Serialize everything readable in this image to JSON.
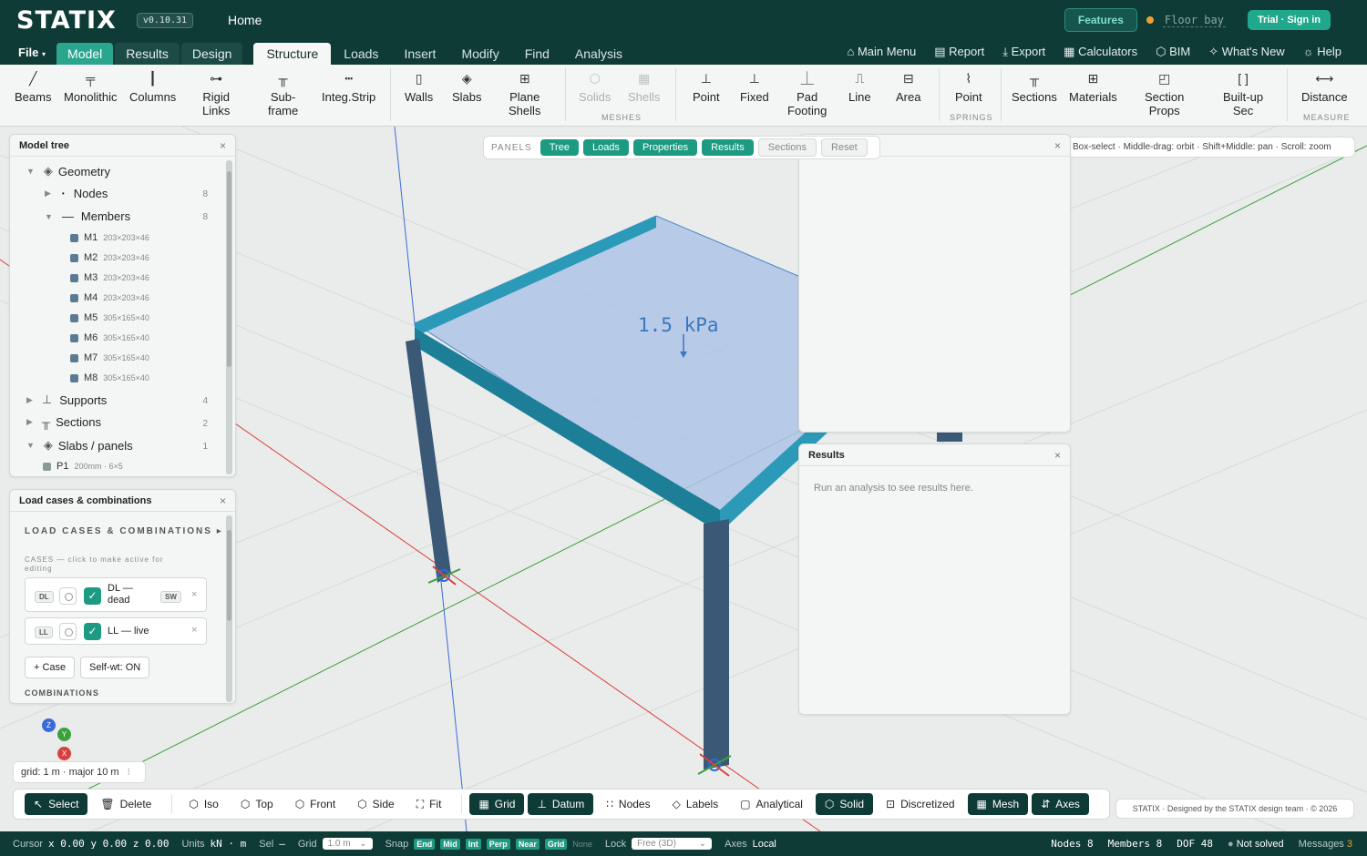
{
  "app": {
    "logo": "STATIX",
    "version": "v0.10.31",
    "home": "Home",
    "features": "Features",
    "project": "Floor bay",
    "trial": "Trial · Sign in"
  },
  "menu": {
    "file": "File",
    "tabs": [
      "Model",
      "Results",
      "Design"
    ],
    "subtabs": [
      "Structure",
      "Loads",
      "Insert",
      "Modify",
      "Find",
      "Analysis"
    ],
    "right": [
      "Main Menu",
      "Report",
      "Export",
      "Calculators",
      "BIM",
      "What's New",
      "Help"
    ]
  },
  "ribbon": {
    "items": [
      {
        "label": "Beams",
        "icon": "╱"
      },
      {
        "label": "Monolithic",
        "icon": "╤"
      },
      {
        "label": "Columns",
        "icon": "┃"
      },
      {
        "label": "Rigid\nLinks",
        "icon": "⊶"
      },
      {
        "label": "Sub-\nframe",
        "icon": "╥"
      },
      {
        "label": "Integ.Strip",
        "icon": "┅"
      },
      {
        "label": "Walls",
        "icon": "▯"
      },
      {
        "label": "Slabs",
        "icon": "◈"
      },
      {
        "label": "Plane\nShells",
        "icon": "⊞"
      },
      {
        "label": "Solids",
        "icon": "⬡"
      },
      {
        "label": "Shells",
        "icon": "▦"
      },
      {
        "label": "Point",
        "icon": "⊥"
      },
      {
        "label": "Fixed",
        "icon": "⊥"
      },
      {
        "label": "Pad\nFooting",
        "icon": "⏊"
      },
      {
        "label": "Line",
        "icon": "⎍"
      },
      {
        "label": "Area",
        "icon": "⊟"
      },
      {
        "label": "Point",
        "icon": "⌇"
      },
      {
        "label": "Sections",
        "icon": "╥"
      },
      {
        "label": "Materials",
        "icon": "⊞"
      },
      {
        "label": "Section\nProps",
        "icon": "◰"
      },
      {
        "label": "Built-up\nSec",
        "icon": "[ ]"
      },
      {
        "label": "Distance",
        "icon": "⟷"
      }
    ],
    "groups": [
      "MESHES",
      "SPRINGS",
      "MEASURE"
    ]
  },
  "tree": {
    "title": "Model tree",
    "geometry": "Geometry",
    "nodes": "Nodes",
    "nodes_count": "8",
    "members": "Members",
    "members_count": "8",
    "member_list": [
      {
        "id": "M1",
        "sec": "203×203×46"
      },
      {
        "id": "M2",
        "sec": "203×203×46"
      },
      {
        "id": "M3",
        "sec": "203×203×46"
      },
      {
        "id": "M4",
        "sec": "203×203×46"
      },
      {
        "id": "M5",
        "sec": "305×165×40"
      },
      {
        "id": "M6",
        "sec": "305×165×40"
      },
      {
        "id": "M7",
        "sec": "305×165×40"
      },
      {
        "id": "M8",
        "sec": "305×165×40"
      }
    ],
    "supports": "Supports",
    "supports_count": "4",
    "sections": "Sections",
    "sections_count": "2",
    "slabs": "Slabs / panels",
    "slabs_count": "1",
    "p1": "P1",
    "p1_desc": "200mm · 6×5"
  },
  "loads": {
    "title": "Load cases & combinations",
    "heading": "LOAD CASES & COMBINATIONS ▸",
    "cases_label": "CASES — click to make active for editing",
    "cases": [
      {
        "tag": "DL",
        "name": "DL —\ndead",
        "sw": "SW"
      },
      {
        "tag": "LL",
        "name": "LL — live"
      }
    ],
    "add_case": "+ Case",
    "selfwt": "Self-wt: ON",
    "combinations": "COMBINATIONS"
  },
  "panels": {
    "label": "PANELS",
    "buttons": [
      "Tree",
      "Loads",
      "Properties",
      "Results",
      "Sections",
      "Reset"
    ]
  },
  "hint": "Box-select · Middle-drag: orbit · Shift+Middle: pan · Scroll: zoom",
  "results": {
    "title": "Results",
    "message": "Run an analysis to see results here."
  },
  "viewport": {
    "load_label": "1.5 kPa",
    "axis_z": "Z",
    "axis_y": "Y",
    "axis_x": "X",
    "grid": "grid: 1 m · major 10 m"
  },
  "toolbar": {
    "select": "Select",
    "delete": "Delete",
    "iso": "Iso",
    "top": "Top",
    "front": "Front",
    "side": "Side",
    "fit": "Fit",
    "grid": "Grid",
    "datum": "Datum",
    "nodes": "Nodes",
    "labels": "Labels",
    "analytical": "Analytical",
    "solid": "Solid",
    "discretized": "Discretized",
    "mesh": "Mesh",
    "axes": "Axes"
  },
  "credit": "STATIX · Designed by the STATIX design team · © 2026",
  "status": {
    "cursor_label": "Cursor",
    "cursor": "x 0.00 y 0.00 z 0.00",
    "units_label": "Units",
    "units": "kN · m",
    "sel_label": "Sel",
    "sel": "—",
    "grid_label": "Grid",
    "grid": "1.0 m",
    "snap_label": "Snap",
    "snaps": [
      "End",
      "Mid",
      "Int",
      "Perp",
      "Near",
      "Grid"
    ],
    "snap_none": "None",
    "lock_label": "Lock",
    "lock": "Free (3D)",
    "axes_label": "Axes",
    "axes": "Local",
    "nodes": "Nodes 8",
    "members": "Members 8",
    "dof": "DOF 48",
    "solved": "Not solved",
    "messages_label": "Messages",
    "messages": "3"
  }
}
